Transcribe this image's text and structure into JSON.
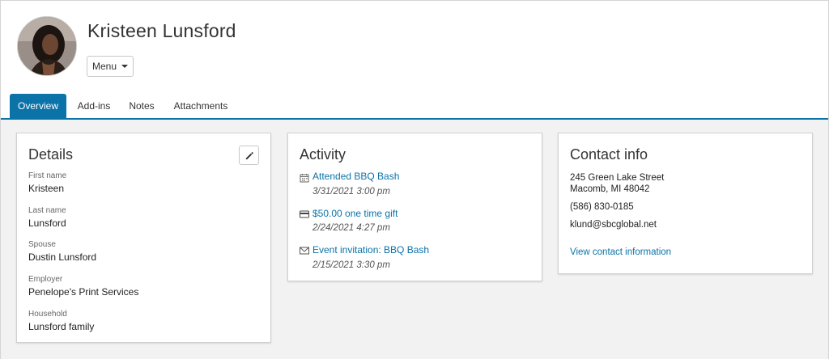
{
  "profile": {
    "name": "Kristeen Lunsford",
    "menu_label": "Menu"
  },
  "tabs": [
    {
      "label": "Overview",
      "active": true
    },
    {
      "label": "Add-ins",
      "active": false
    },
    {
      "label": "Notes",
      "active": false
    },
    {
      "label": "Attachments",
      "active": false
    }
  ],
  "details": {
    "title": "Details",
    "fields": [
      {
        "label": "First name",
        "value": "Kristeen"
      },
      {
        "label": "Last name",
        "value": "Lunsford"
      },
      {
        "label": "Spouse",
        "value": "Dustin Lunsford"
      },
      {
        "label": "Employer",
        "value": "Penelope's Print Services"
      },
      {
        "label": "Household",
        "value": "Lunsford family"
      }
    ]
  },
  "activity": {
    "title": "Activity",
    "items": [
      {
        "icon": "calendar-icon",
        "label": "Attended BBQ Bash",
        "date": "3/31/2021 3:00 pm"
      },
      {
        "icon": "credit-card-icon",
        "label": "$50.00 one time gift",
        "date": "2/24/2021 4:27 pm"
      },
      {
        "icon": "envelope-icon",
        "label": "Event invitation: BBQ Bash",
        "date": "2/15/2021 3:30 pm"
      }
    ]
  },
  "contact": {
    "title": "Contact info",
    "address_line1": "245 Green Lake Street",
    "address_line2": "Macomb, MI 48042",
    "phone": "(586) 830-0185",
    "email": "klund@sbcglobal.net",
    "link_label": "View contact information"
  },
  "colors": {
    "accent": "#0b73a8",
    "background": "#f2f2f2"
  }
}
